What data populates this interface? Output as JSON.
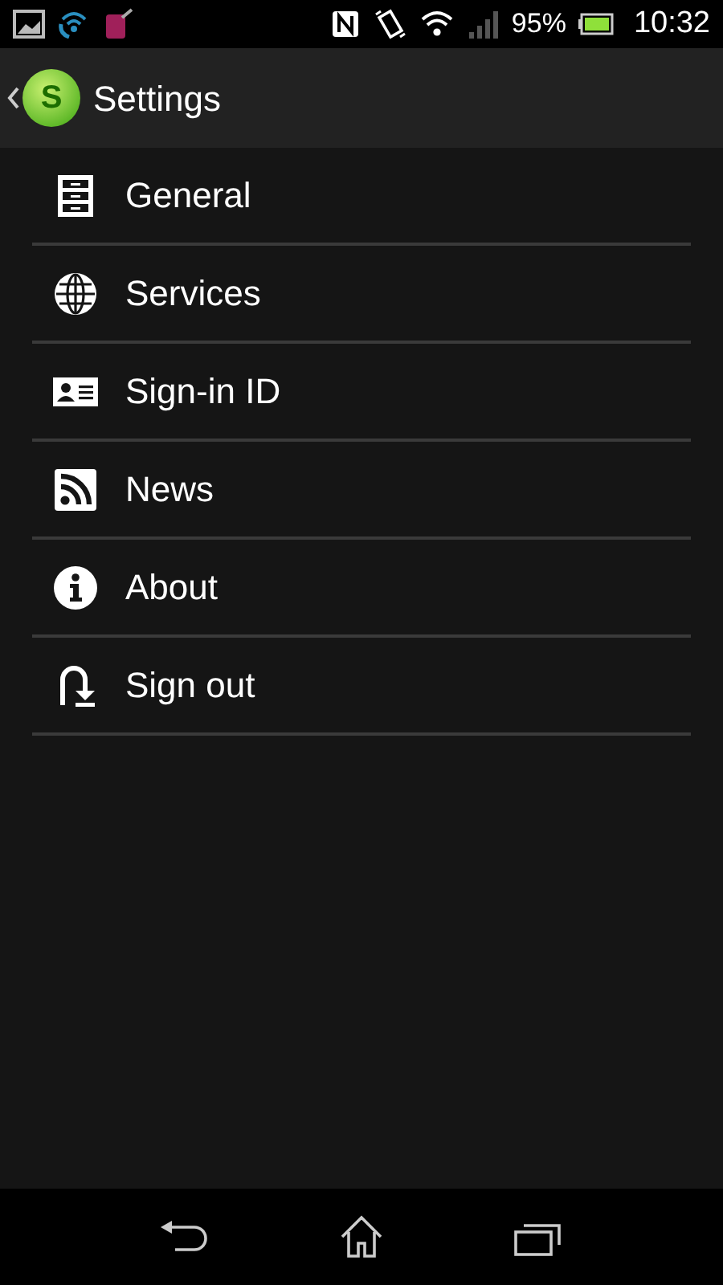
{
  "status_bar": {
    "battery": "95%",
    "time": "10:32"
  },
  "title_bar": {
    "logo_letter": "S",
    "title": "Settings"
  },
  "items": [
    {
      "label": "General",
      "kind": "cabinet"
    },
    {
      "label": "Services",
      "kind": "globe"
    },
    {
      "label": "Sign-in ID",
      "kind": "id-card"
    },
    {
      "label": "News",
      "kind": "rss"
    },
    {
      "label": "About",
      "kind": "info"
    },
    {
      "label": "Sign out",
      "kind": "signout"
    }
  ]
}
